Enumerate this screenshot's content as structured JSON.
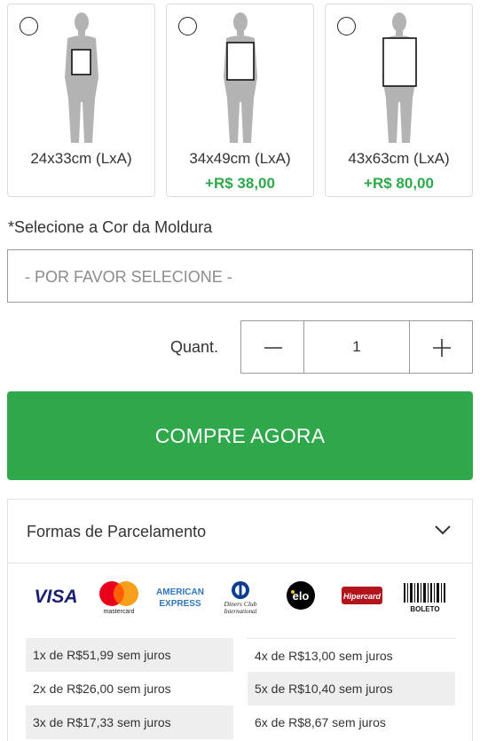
{
  "sizes": [
    {
      "label": "24x33cm (LxA)",
      "price": ""
    },
    {
      "label": "34x49cm (LxA)",
      "price": "+R$ 38,00"
    },
    {
      "label": "43x63cm (LxA)",
      "price": "+R$ 80,00"
    }
  ],
  "frame_color": {
    "label": "*Selecione a Cor da Moldura",
    "placeholder": "- POR FAVOR SELECIONE -"
  },
  "quantity": {
    "label": "Quant.",
    "value": "1"
  },
  "buy_button": "COMPRE AGORA",
  "installments": {
    "title": "Formas de Parcelamento",
    "payment_methods": [
      {
        "name": "VISA",
        "icon": "visa-logo"
      },
      {
        "name": "mastercard",
        "icon": "mastercard-logo"
      },
      {
        "name": "AMERICAN EXPRESS",
        "icon": "amex-logo"
      },
      {
        "name": "Diners Club International",
        "icon": "diners-logo"
      },
      {
        "name": "elo",
        "icon": "elo-logo"
      },
      {
        "name": "Hipercard",
        "icon": "hipercard-logo"
      },
      {
        "name": "BOLETO",
        "icon": "boleto-logo"
      }
    ],
    "plans_left": [
      "1x de R$51,99 sem juros",
      "2x de R$26,00 sem juros",
      "3x de R$17,33 sem juros"
    ],
    "plans_right": [
      "4x de R$13,00 sem juros",
      "5x de R$10,40 sem juros",
      "6x de R$8,67 sem juros"
    ]
  },
  "colors": {
    "accent_green": "#2ea84a",
    "silhouette_gray": "#b3b3b3",
    "visa_blue": "#1a1f71",
    "amex_blue": "#2e77bc",
    "hipercard_red": "#b3131b"
  }
}
